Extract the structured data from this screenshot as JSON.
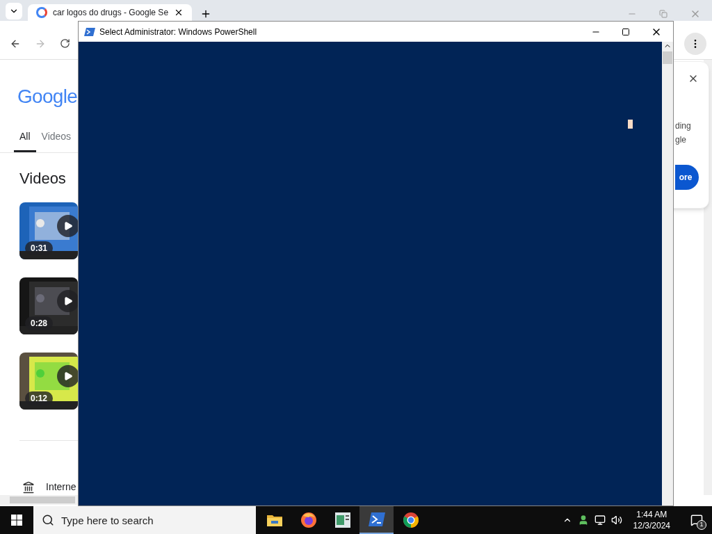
{
  "browser": {
    "tab": {
      "title": "car logos do drugs - Google Se",
      "selected": true
    },
    "logo": "Google",
    "search_tabs": [
      {
        "label": "All",
        "selected": true
      },
      {
        "label": "Videos",
        "selected": false
      }
    ],
    "section_title": "Videos",
    "videos": [
      {
        "duration": "0:31"
      },
      {
        "duration": "0:28"
      },
      {
        "duration": "0:12"
      }
    ],
    "result_title": "Interne",
    "popup": {
      "lines": [
        "ding",
        "gle"
      ],
      "button": "ore"
    }
  },
  "powershell": {
    "title": "Select Administrator: Windows PowerShell"
  },
  "taskbar": {
    "search_placeholder": "Type here to search",
    "apps": [
      {
        "kind": "explorer",
        "selected": false
      },
      {
        "kind": "firefox",
        "selected": false
      },
      {
        "kind": "app",
        "selected": false
      },
      {
        "kind": "powershell",
        "selected": true
      },
      {
        "kind": "chrome",
        "selected": false
      }
    ],
    "time": "1:44 AM",
    "date": "12/3/2024",
    "notifications": "1"
  }
}
